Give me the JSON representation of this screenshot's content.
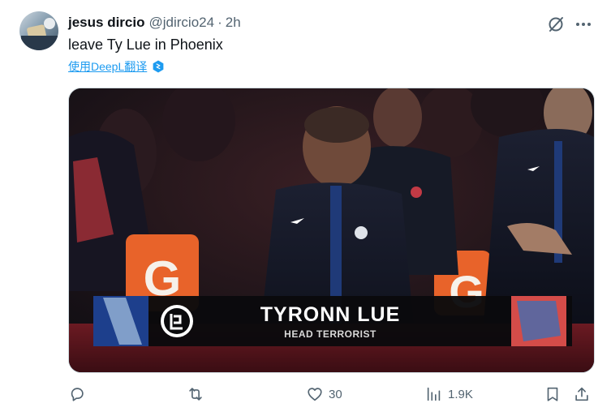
{
  "tweet": {
    "display_name": "jesus dircio",
    "handle": "@jdircio24",
    "separator": "·",
    "time": "2h",
    "text": "leave Ty Lue in Phoenix",
    "translate_label": "使用DeepL翻译",
    "icons": {
      "grok": "grok-icon",
      "more": "more-dots-icon",
      "deepl": "deepl-icon"
    }
  },
  "media": {
    "caption_name": "TYRONN LUE",
    "caption_title": "HEAD TERRORIST",
    "scene": [
      "arena-crowd",
      "coach-courtside",
      "clippers-logo-chyron"
    ]
  },
  "actions": {
    "reply": {
      "icon": "reply-icon",
      "count": ""
    },
    "repost": {
      "icon": "repost-icon",
      "count": ""
    },
    "like": {
      "icon": "heart-icon",
      "count": "30"
    },
    "views": {
      "icon": "views-icon",
      "count": "1.9K"
    },
    "bookmark": {
      "icon": "bookmark-icon"
    },
    "share": {
      "icon": "share-icon"
    }
  },
  "colors": {
    "text_primary": "#0f1419",
    "text_secondary": "#536471",
    "link": "#1d9bf0",
    "border": "#cfd9de"
  }
}
